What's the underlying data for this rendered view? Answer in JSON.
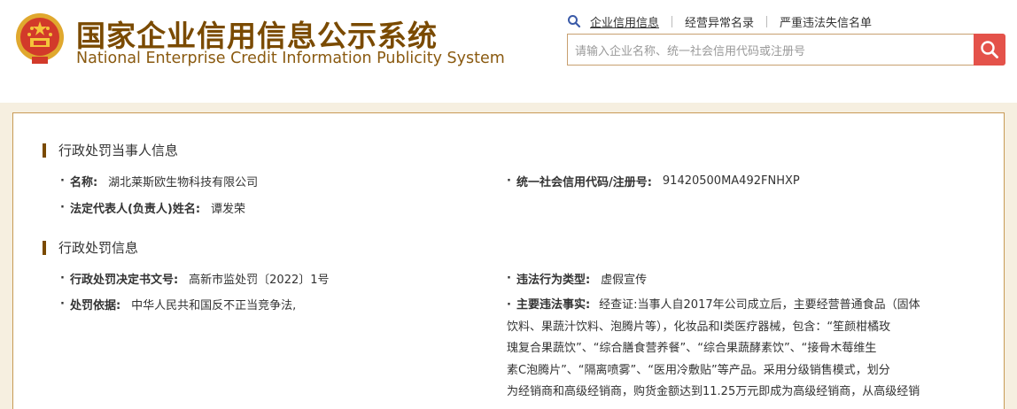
{
  "header": {
    "title_zh": "国家企业信用信息公示系统",
    "title_en": "National Enterprise Credit Information Publicity System",
    "nav": [
      {
        "label": "企业信用信息"
      },
      {
        "label": "经营异常名录"
      },
      {
        "label": "严重违法失信名单"
      }
    ],
    "search_placeholder": "请输入企业名称、统一社会信用代码或注册号",
    "colors": {
      "brand": "#7a4a00",
      "search_button": "#e4524a"
    }
  },
  "party_section": {
    "title": "行政处罚当事人信息",
    "name_label": "名称:",
    "name_value": "湖北莱斯欧生物科技有限公司",
    "credit_code_label": "统一社会信用代码/注册号:",
    "credit_code_value": "91420500MA492FNHXP",
    "legal_rep_label": "法定代表人(负责人)姓名:",
    "legal_rep_value": "谭发荣"
  },
  "penalty_section": {
    "title": "行政处罚信息",
    "decision_no_label": "行政处罚决定书文号:",
    "decision_no_value": "高新市监处罚〔2022〕1号",
    "violation_type_label": "违法行为类型:",
    "violation_type_value": "虚假宣传",
    "basis_label": "处罚依据:",
    "basis_value": "中华人民共和国反不正当竞争法,",
    "facts_label": "主要违法事实:",
    "facts_lines": [
      "经查证:当事人自2017年公司成立后，主要经营普通食品（固体",
      "饮料、果蔬汁饮料、泡腾片等），化妆品和Ⅰ类医疗器械，包含：“笙颜柑橘玫",
      "瑰复合果蔬饮”、“综合膳食营养餐”、“综合果蔬酵素饮”、“接骨木莓维生",
      "素C泡腾片”、“隔离喷雾”、“医用冷敷贴”等产品。采用分级销售模式，划分",
      "为经销商和高级经销商，购货金额达到11.25万元即成为高级经销商，从高级经销"
    ]
  }
}
